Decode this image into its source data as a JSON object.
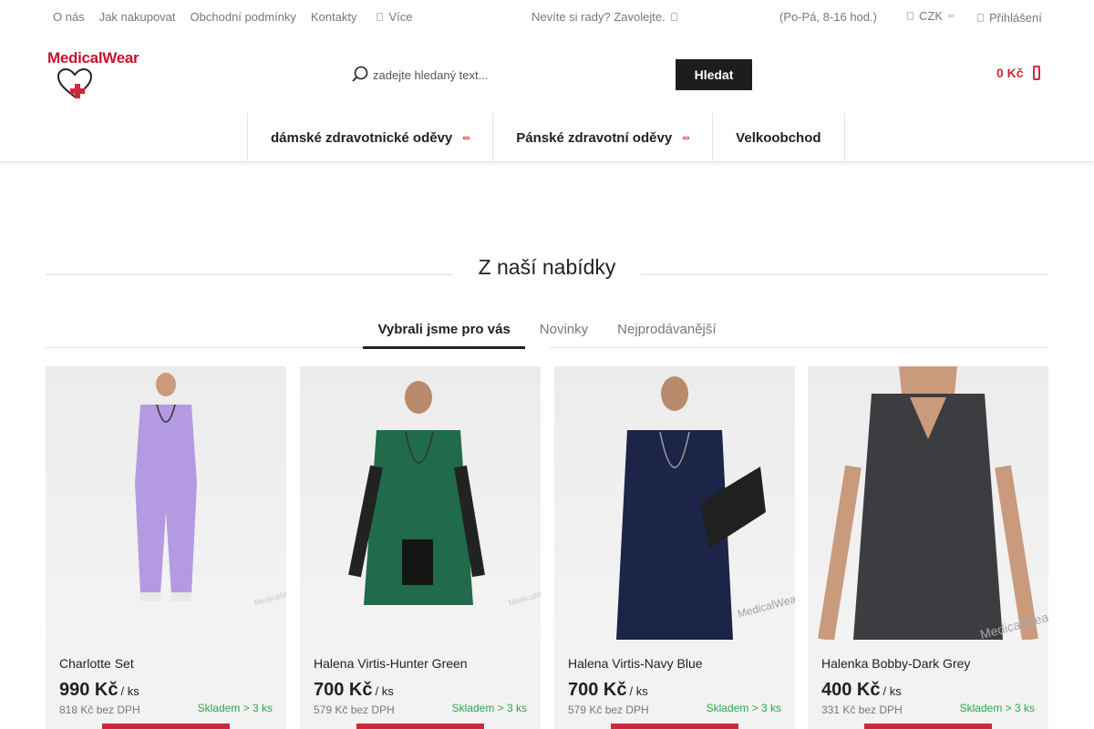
{
  "topbar": {
    "links": [
      "O nás",
      "Jak nakupovat",
      "Obchodní podmínky",
      "Kontakty"
    ],
    "more_label": "Více",
    "help_text": "Nevíte si rady? Zavolejte.",
    "hours": "(Po-Pá, 8-16 hod.)",
    "currency": "CZK",
    "login": "Přihlášení"
  },
  "header": {
    "logo_text": "MedicalWear",
    "search_placeholder": "zadejte hledaný text...",
    "search_button": "Hledat",
    "cart_total": "0 Kč"
  },
  "nav": {
    "items": [
      {
        "label": "dámské zdravotnické oděvy",
        "has_submenu": true
      },
      {
        "label": "Pánské zdravotní oděvy",
        "has_submenu": true
      },
      {
        "label": "Velkoobchod",
        "has_submenu": false
      }
    ]
  },
  "section": {
    "title": "Z naší nabídky",
    "tabs": [
      {
        "label": "Vybrali jsme pro vás",
        "active": true
      },
      {
        "label": "Novinky",
        "active": false
      },
      {
        "label": "Nejprodávanější",
        "active": false
      }
    ]
  },
  "products": [
    {
      "name": "Charlotte Set",
      "price": "990 Kč",
      "unit": "/ ks",
      "net": "818 Kč bez DPH",
      "stock": "Skladem > 3 ks",
      "garment_color": "#b49ae0"
    },
    {
      "name": "Halena Virtis-Hunter Green",
      "price": "700 Kč",
      "unit": "/ ks",
      "net": "579 Kč bez DPH",
      "stock": "Skladem > 3 ks",
      "garment_color": "#1f6b4b"
    },
    {
      "name": "Halena Virtis-Navy Blue",
      "price": "700 Kč",
      "unit": "/ ks",
      "net": "579 Kč bez DPH",
      "stock": "Skladem > 3 ks",
      "garment_color": "#1c2447"
    },
    {
      "name": "Halenka Bobby-Dark Grey",
      "price": "400 Kč",
      "unit": "/ ks",
      "net": "331 Kč bez DPH",
      "stock": "Skladem > 3 ks",
      "garment_color": "#3b3d40"
    }
  ],
  "colors": {
    "accent": "#d0283b",
    "stock_green": "#2aa847",
    "button_dark": "#1d1d1d"
  }
}
